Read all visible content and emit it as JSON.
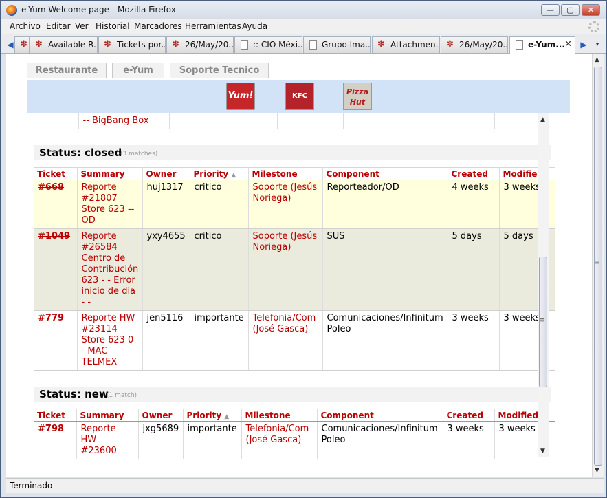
{
  "window": {
    "title": "e-Yum Welcome page - Mozilla Firefox",
    "buttons": {
      "minimize": "—",
      "maximize": "▢",
      "close": "✕"
    }
  },
  "menu": [
    "Archivo",
    "Editar",
    "Ver",
    "Historial",
    "Marcadores",
    "Herramientas",
    "Ayuda"
  ],
  "tabs": [
    {
      "label": "...",
      "icon": "paw-icon"
    },
    {
      "label": "Available R...",
      "icon": "paw-icon"
    },
    {
      "label": "Tickets por...",
      "icon": "paw-icon"
    },
    {
      "label": "26/May/20...",
      "icon": "paw-icon"
    },
    {
      "label": ":: CIO Méxi...",
      "icon": "doc-icon"
    },
    {
      "label": "Grupo Ima...",
      "icon": "doc-icon"
    },
    {
      "label": "Attachmen...",
      "icon": "paw-icon"
    },
    {
      "label": "26/May/20...",
      "icon": "paw-icon"
    },
    {
      "label": "e-Yum...",
      "icon": "doc-icon",
      "active": true
    }
  ],
  "page_nav": [
    "Restaurante",
    "e-Yum",
    "Soporte Tecnico"
  ],
  "logos": [
    "Yum!",
    "KFC",
    "Pizza Hut"
  ],
  "continued_row": {
    "summary": "-- BigBang Box"
  },
  "headers": [
    "Ticket",
    "Summary",
    "Owner",
    "Priority",
    "Milestone",
    "Component",
    "Created",
    "Modified"
  ],
  "groups": [
    {
      "title": "Status: closed",
      "count": "(3 matches)",
      "rows": [
        {
          "id": "#668",
          "summary": "Reporte #21807 Store 623 -- OD",
          "owner": "huj1317",
          "priority": "critico",
          "milestone": "Soporte (Jesús Noriega)",
          "component": "Reporteador/OD",
          "created": "4 weeks",
          "modified": "3 weeks"
        },
        {
          "id": "#1049",
          "summary": "Reporte #26584 Centro de Contribución 623 - - Error inicio de dia - -",
          "owner": "yxy4655",
          "priority": "critico",
          "milestone": "Soporte (Jesús Noriega)",
          "component": "SUS",
          "created": "5 days",
          "modified": "5 days"
        },
        {
          "id": "#779",
          "summary": "Reporte HW #23114 Store 623 0 - MAC TELMEX",
          "owner": "jen5116",
          "priority": "importante",
          "milestone": "Telefonia/Com (José Gasca)",
          "component": "Comunicaciones/Infinitum Poleo",
          "created": "3 weeks",
          "modified": "3 weeks"
        }
      ]
    },
    {
      "title": "Status: new",
      "count": "(1 match)",
      "rows": [
        {
          "id": "#798",
          "summary": "Reporte HW #23600",
          "owner": "jxg5689",
          "priority": "importante",
          "milestone": "Telefonia/Com (José Gasca)",
          "component": "Comunicaciones/Infinitum Poleo",
          "created": "3 weeks",
          "modified": "3 weeks"
        }
      ]
    }
  ],
  "status_bar": "Terminado"
}
